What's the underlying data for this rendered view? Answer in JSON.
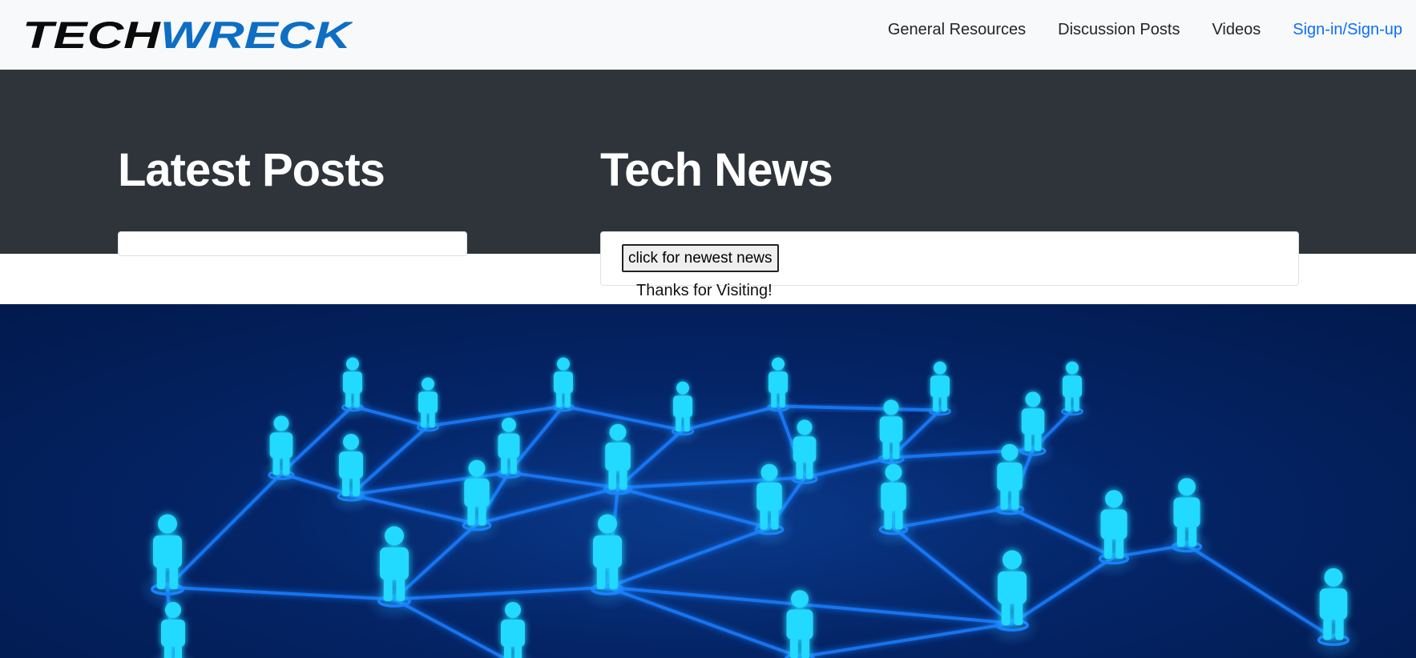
{
  "brand": {
    "part1": "TECH",
    "part2": "WRECK",
    "color1": "#0b0b0b",
    "color2": "#0d6ec4"
  },
  "nav": {
    "items": [
      "General Resources",
      "Discussion Posts",
      "Videos"
    ],
    "signin": "Sign-in/Sign-up",
    "signin_color": "#0d6efd"
  },
  "sections": {
    "latest_posts_title": "Latest Posts",
    "tech_news_title": "Tech News",
    "news_button": "click for newest news",
    "thanks": "Thanks for Visiting!"
  },
  "hero": {
    "image": "network-of-people-illustration"
  },
  "colors": {
    "navbar_bg": "#f8f9fa",
    "band_bg": "#2f343b",
    "hero_bg": "#042466",
    "glow": "#1fd8ff"
  }
}
